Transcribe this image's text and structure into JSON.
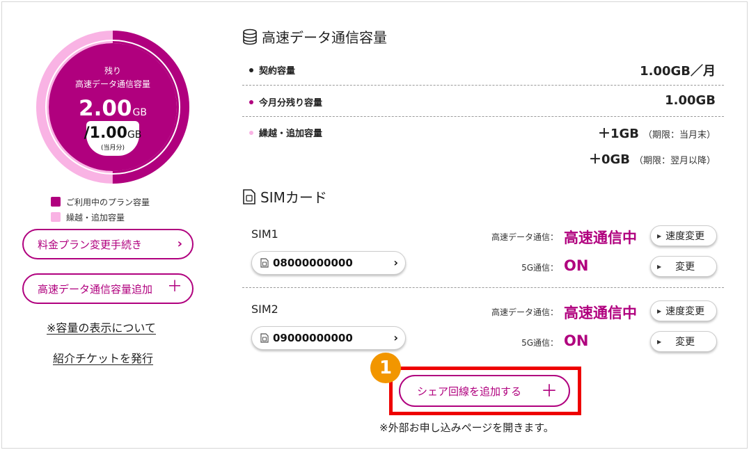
{
  "donut": {
    "remain_label": "残り",
    "sub_label": "高速データ通信容量",
    "remaining_value": "2.00",
    "remaining_unit": "GB",
    "total_value": "/1.00",
    "total_unit": "GB",
    "month_label": "(当月分)",
    "plan_fraction": 0.5,
    "colors": {
      "plan": "#b0007e",
      "carry": "#f9b3e4"
    }
  },
  "legend": [
    {
      "label": "ご利用中のプラン容量",
      "color": "#b0007e"
    },
    {
      "label": "繰越・追加容量",
      "color": "#f9b3e4"
    }
  ],
  "left_actions": {
    "plan_change": {
      "label": "料金プラン変更手続き",
      "icon": "chevron-right"
    },
    "add_capacity": {
      "label": "高速データ通信容量追加",
      "icon": "plus"
    },
    "capacity_note_link": "※容量の表示について",
    "referral_link": "紹介チケットを発行"
  },
  "capacity": {
    "title": "高速データ通信容量",
    "icon": "database-icon",
    "rows": [
      {
        "label": "契約容量",
        "value": "1.00GB／月",
        "note": "",
        "dot_color": "#222222"
      },
      {
        "label": "今月分残り容量",
        "value": "1.00GB",
        "note": "",
        "dot_color": "#b0007e"
      },
      {
        "label": "繰越・追加容量",
        "value": "＋1GB",
        "note": "（期限：当月末）",
        "dot_color": "#f9b3e4"
      }
    ],
    "extra": {
      "value": "＋0GB",
      "note": "（期限：翌月以降）"
    }
  },
  "sim": {
    "title": "SIMカード",
    "icon": "sim-card-icon",
    "cards": [
      {
        "name": "SIM1",
        "number": "08000000000",
        "speed_label": "高速データ通信：",
        "speed_value": "高速通信中",
        "speed_button": "速度変更",
        "fiveg_label": "5G通信：",
        "fiveg_value": "ON",
        "fiveg_button": "変更"
      },
      {
        "name": "SIM2",
        "number": "09000000000",
        "speed_label": "高速データ通信：",
        "speed_value": "高速通信中",
        "speed_button": "速度変更",
        "fiveg_label": "5G通信：",
        "fiveg_value": "ON",
        "fiveg_button": "変更"
      }
    ]
  },
  "share": {
    "badge": "1",
    "button_label": "シェア回線を追加する",
    "note": "※外部お申し込みページを開きます。",
    "highlight_color": "#ee0000"
  }
}
